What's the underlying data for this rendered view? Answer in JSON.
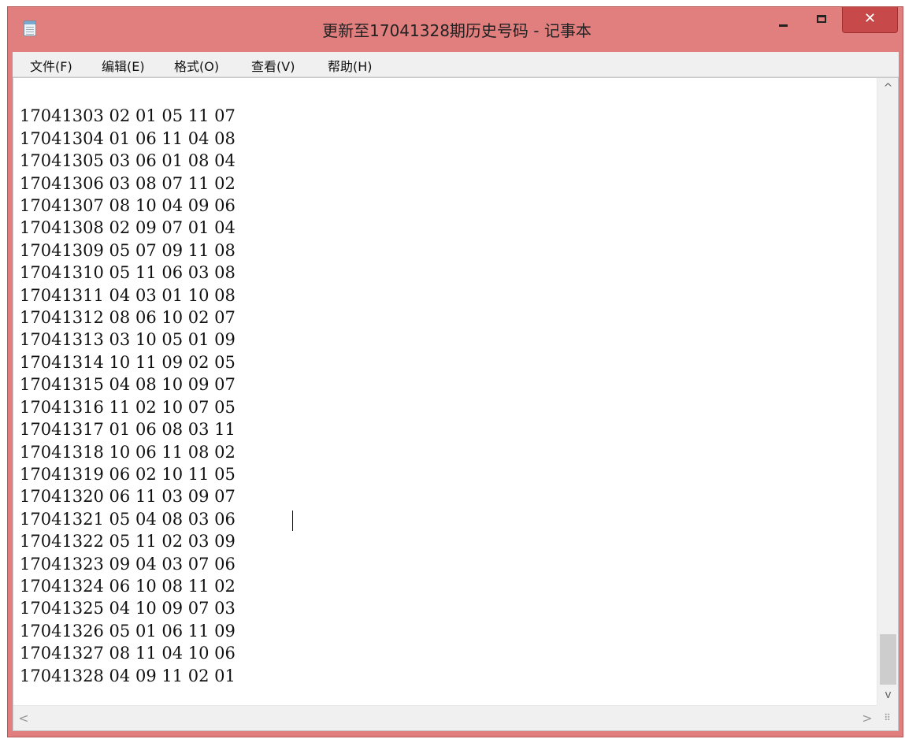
{
  "window": {
    "title": "更新至17041328期历史号码 - 记事本",
    "controls": {
      "minimize": "minimize",
      "maximize": "maximize",
      "close_symbol": "✕"
    },
    "accent_color": "#e17e7e",
    "close_color": "#c74949"
  },
  "menu": [
    {
      "label": "文件(F)"
    },
    {
      "label": "编辑(E)"
    },
    {
      "label": "格式(O)"
    },
    {
      "label": "查看(V)"
    },
    {
      "label": "帮助(H)"
    }
  ],
  "document": {
    "lines": [
      "17041303 02 01 05 11 07",
      "17041304 01 06 11 04 08",
      "17041305 03 06 01 08 04",
      "17041306 03 08 07 11 02",
      "17041307 08 10 04 09 06",
      "17041308 02 09 07 01 04",
      "17041309 05 07 09 11 08",
      "17041310 05 11 06 03 08",
      "17041311 04 03 01 10 08",
      "17041312 08 06 10 02 07",
      "17041313 03 10 05 01 09",
      "17041314 10 11 09 02 05",
      "17041315 04 08 10 09 07",
      "17041316 11 02 10 07 05",
      "17041317 01 06 08 03 11",
      "17041318 10 06 11 08 02",
      "17041319 06 02 10 11 05",
      "17041320 06 11 03 09 07",
      "17041321 05 04 08 03 06",
      "17041322 05 11 02 03 09 ",
      "17041323 09 04 03 07 06",
      "17041324 06 10 08 11 02",
      "17041325 04 10 09 07 03",
      "17041326 05 01 06 11 09",
      "17041327 08 11 04 10 06",
      "17041328 04 09 11 02 01"
    ]
  },
  "scrollbars": {
    "up_arrow": "^",
    "down_arrow": "v",
    "left_arrow": "<",
    "right_arrow": ">",
    "grip": "⠿"
  }
}
